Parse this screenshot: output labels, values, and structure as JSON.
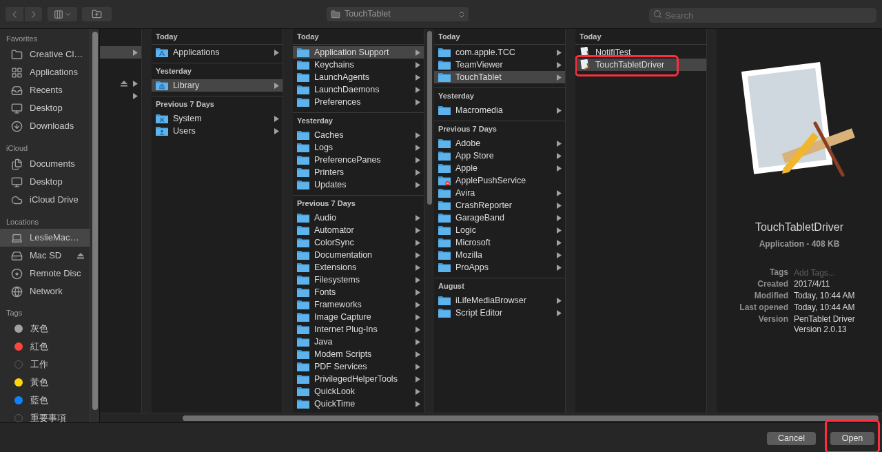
{
  "toolbar": {
    "path": "TouchTablet",
    "search": {
      "placeholder": "Search"
    }
  },
  "sidebar": {
    "sections": [
      {
        "title": "Favorites",
        "items": [
          {
            "label": "Creative Cl…",
            "kind": "folder",
            "selected": false,
            "eject": false
          },
          {
            "label": "Applications",
            "kind": "apps",
            "selected": false,
            "eject": false
          },
          {
            "label": "Recents",
            "kind": "recents",
            "selected": false,
            "eject": false
          },
          {
            "label": "Desktop",
            "kind": "desktop",
            "selected": false,
            "eject": false
          },
          {
            "label": "Downloads",
            "kind": "downloads",
            "selected": false,
            "eject": false
          }
        ]
      },
      {
        "title": "iCloud",
        "items": [
          {
            "label": "Documents",
            "kind": "documents",
            "selected": false,
            "eject": false
          },
          {
            "label": "Desktop",
            "kind": "desktop",
            "selected": false,
            "eject": false
          },
          {
            "label": "iCloud Drive",
            "kind": "cloud",
            "selected": false,
            "eject": false
          }
        ]
      },
      {
        "title": "Locations",
        "items": [
          {
            "label": "LeslieMac…",
            "kind": "laptop",
            "selected": true,
            "eject": false
          },
          {
            "label": "Mac SD",
            "kind": "drive",
            "selected": false,
            "eject": true
          },
          {
            "label": "Remote Disc",
            "kind": "disc",
            "selected": false,
            "eject": false
          },
          {
            "label": "Network",
            "kind": "network",
            "selected": false,
            "eject": false
          }
        ]
      }
    ],
    "tags": {
      "title": "Tags",
      "items": [
        {
          "label": "灰色",
          "kind": "filled",
          "color": "#a1a1a6"
        },
        {
          "label": "紅色",
          "kind": "filled",
          "color": "#ff453a"
        },
        {
          "label": "工作",
          "kind": "hollow"
        },
        {
          "label": "黃色",
          "kind": "filled",
          "color": "#ffd60a"
        },
        {
          "label": "藍色",
          "kind": "filled",
          "color": "#0a84ff"
        },
        {
          "label": "重要事項",
          "kind": "hollow"
        }
      ]
    }
  },
  "cut_column": {
    "rows": [
      {
        "selected": true,
        "eject": false
      },
      {
        "selected": false,
        "eject": true
      },
      {
        "selected": false,
        "eject": false
      }
    ]
  },
  "columns": [
    {
      "groups": [
        {
          "header": "Today",
          "items": [
            {
              "name": "Applications",
              "kind": "apps",
              "selected": false,
              "arrow": true
            }
          ]
        },
        {
          "header": "Yesterday",
          "items": [
            {
              "name": "Library",
              "kind": "library",
              "selected": true,
              "arrow": true
            }
          ]
        },
        {
          "header": "Previous 7 Days",
          "items": [
            {
              "name": "System",
              "kind": "system",
              "selected": false,
              "arrow": true
            },
            {
              "name": "Users",
              "kind": "users",
              "selected": false,
              "arrow": true
            }
          ]
        }
      ]
    },
    {
      "groups": [
        {
          "header": "Today",
          "items": [
            {
              "name": "Application Support",
              "kind": "folder",
              "selected": true,
              "arrow": true
            },
            {
              "name": "Keychains",
              "kind": "folder",
              "selected": false,
              "arrow": true
            },
            {
              "name": "LaunchAgents",
              "kind": "folder",
              "selected": false,
              "arrow": true
            },
            {
              "name": "LaunchDaemons",
              "kind": "folder",
              "selected": false,
              "arrow": true
            },
            {
              "name": "Preferences",
              "kind": "folder",
              "selected": false,
              "arrow": true
            }
          ]
        },
        {
          "header": "Yesterday",
          "items": [
            {
              "name": "Caches",
              "kind": "folder",
              "selected": false,
              "arrow": true
            },
            {
              "name": "Logs",
              "kind": "folder",
              "selected": false,
              "arrow": true
            },
            {
              "name": "PreferencePanes",
              "kind": "folder",
              "selected": false,
              "arrow": true
            },
            {
              "name": "Printers",
              "kind": "folder",
              "selected": false,
              "arrow": true
            },
            {
              "name": "Updates",
              "kind": "folder",
              "selected": false,
              "arrow": true
            }
          ]
        },
        {
          "header": "Previous 7 Days",
          "items": [
            {
              "name": "Audio",
              "kind": "folder",
              "selected": false,
              "arrow": true
            },
            {
              "name": "Automator",
              "kind": "folder",
              "selected": false,
              "arrow": true
            },
            {
              "name": "ColorSync",
              "kind": "folder",
              "selected": false,
              "arrow": true
            },
            {
              "name": "Documentation",
              "kind": "folder",
              "selected": false,
              "arrow": true
            },
            {
              "name": "Extensions",
              "kind": "folder",
              "selected": false,
              "arrow": true
            },
            {
              "name": "Filesystems",
              "kind": "folder",
              "selected": false,
              "arrow": true
            },
            {
              "name": "Fonts",
              "kind": "folder",
              "selected": false,
              "arrow": true
            },
            {
              "name": "Frameworks",
              "kind": "folder",
              "selected": false,
              "arrow": true
            },
            {
              "name": "Image Capture",
              "kind": "folder",
              "selected": false,
              "arrow": true
            },
            {
              "name": "Internet Plug-Ins",
              "kind": "folder",
              "selected": false,
              "arrow": true
            },
            {
              "name": "Java",
              "kind": "folder",
              "selected": false,
              "arrow": true
            },
            {
              "name": "Modem Scripts",
              "kind": "folder",
              "selected": false,
              "arrow": true
            },
            {
              "name": "PDF Services",
              "kind": "folder",
              "selected": false,
              "arrow": true
            },
            {
              "name": "PrivilegedHelperTools",
              "kind": "folder",
              "selected": false,
              "arrow": true
            },
            {
              "name": "QuickLook",
              "kind": "folder",
              "selected": false,
              "arrow": true
            },
            {
              "name": "QuickTime",
              "kind": "folder",
              "selected": false,
              "arrow": true
            }
          ]
        }
      ]
    },
    {
      "groups": [
        {
          "header": "Today",
          "items": [
            {
              "name": "com.apple.TCC",
              "kind": "folder",
              "selected": false,
              "arrow": true
            },
            {
              "name": "TeamViewer",
              "kind": "folder",
              "selected": false,
              "arrow": true
            },
            {
              "name": "TouchTablet",
              "kind": "folder",
              "selected": true,
              "arrow": true
            }
          ]
        },
        {
          "header": "Yesterday",
          "items": [
            {
              "name": "Macromedia",
              "kind": "folder",
              "selected": false,
              "arrow": true
            }
          ]
        },
        {
          "header": "Previous 7 Days",
          "items": [
            {
              "name": "Adobe",
              "kind": "folder",
              "selected": false,
              "arrow": true
            },
            {
              "name": "App Store",
              "kind": "folder",
              "selected": false,
              "arrow": true
            },
            {
              "name": "Apple",
              "kind": "folder",
              "selected": false,
              "arrow": true
            },
            {
              "name": "ApplePushService",
              "kind": "blocked",
              "selected": false,
              "arrow": false
            },
            {
              "name": "Avira",
              "kind": "folder",
              "selected": false,
              "arrow": true
            },
            {
              "name": "CrashReporter",
              "kind": "folder",
              "selected": false,
              "arrow": true
            },
            {
              "name": "GarageBand",
              "kind": "folder",
              "selected": false,
              "arrow": true
            },
            {
              "name": "Logic",
              "kind": "folder",
              "selected": false,
              "arrow": true
            },
            {
              "name": "Microsoft",
              "kind": "folder",
              "selected": false,
              "arrow": true
            },
            {
              "name": "Mozilla",
              "kind": "folder",
              "selected": false,
              "arrow": true
            },
            {
              "name": "ProApps",
              "kind": "folder",
              "selected": false,
              "arrow": true
            }
          ]
        },
        {
          "header": "August",
          "items": [
            {
              "name": "iLifeMediaBrowser",
              "kind": "folder",
              "selected": false,
              "arrow": true
            },
            {
              "name": "Script Editor",
              "kind": "folder",
              "selected": false,
              "arrow": true
            }
          ]
        }
      ]
    },
    {
      "groups": [
        {
          "header": "Today",
          "items": [
            {
              "name": "NotifiTest",
              "kind": "app",
              "selected": false,
              "arrow": false,
              "highlighted": false
            },
            {
              "name": "TouchTabletDriver",
              "kind": "app",
              "selected": true,
              "arrow": false,
              "highlighted": true
            }
          ]
        }
      ]
    }
  ],
  "preview": {
    "name": "TouchTabletDriver",
    "subtitle": "Application - 408 KB",
    "details": [
      {
        "label": "Tags",
        "placeholder": "Add Tags..."
      },
      {
        "label": "Created",
        "value": "2017/4/11"
      },
      {
        "label": "Modified",
        "value": "Today, 10:44 AM"
      },
      {
        "label": "Last opened",
        "value": "Today, 10:44 AM"
      },
      {
        "label": "Version",
        "value": "PenTablet Driver Version 2.0.13"
      }
    ]
  },
  "buttons": [
    {
      "label": "Cancel",
      "highlighted": false
    },
    {
      "label": "Open",
      "highlighted": true
    }
  ]
}
